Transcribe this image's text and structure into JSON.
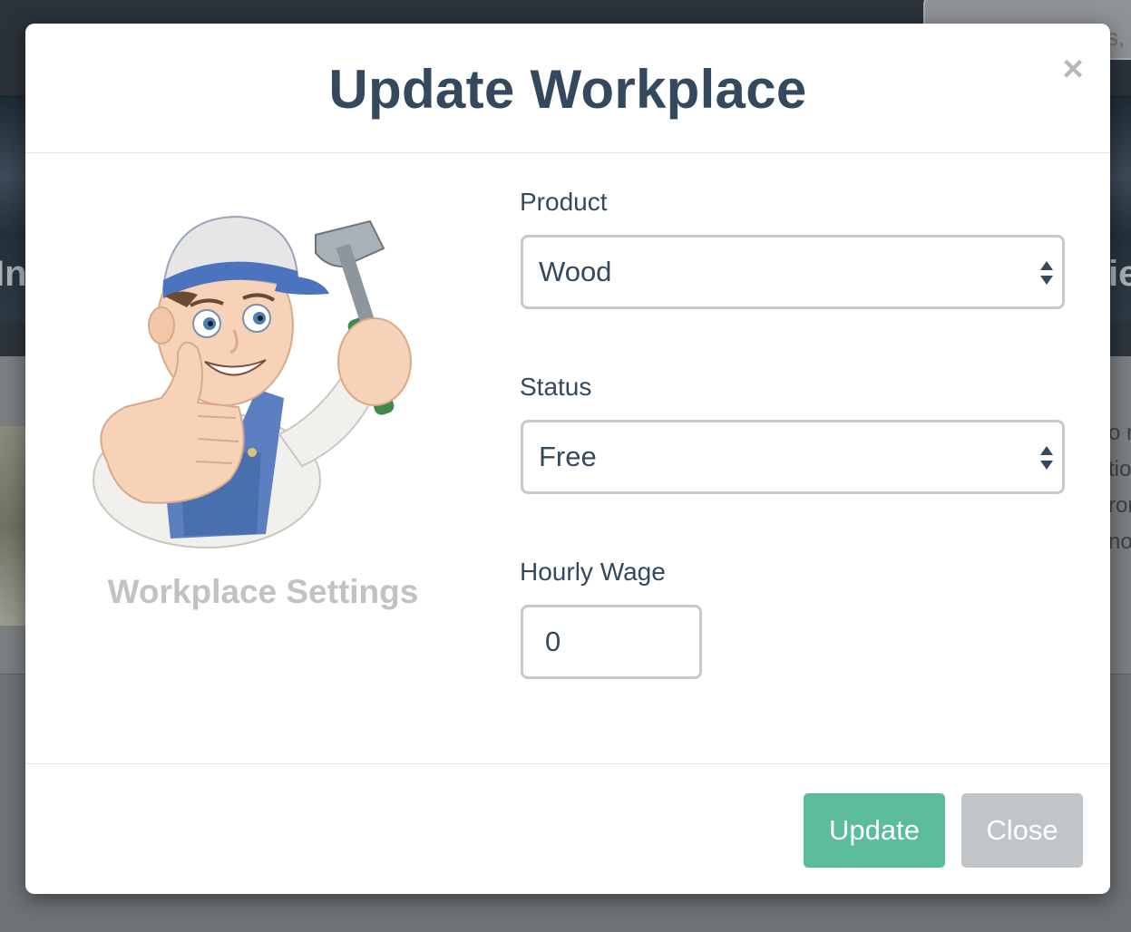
{
  "background": {
    "search_fragment": "s,",
    "hero_left_fragment": "In",
    "hero_right_fragment": "ie",
    "content_fragments": [
      "o r",
      "tio",
      "ror",
      "nov"
    ]
  },
  "modal": {
    "title": "Update Workplace",
    "close_symbol": "×",
    "illustration": "worker-with-hammer-thumbs-up",
    "caption": "Workplace Settings",
    "fields": {
      "product": {
        "label": "Product",
        "value": "Wood"
      },
      "status": {
        "label": "Status",
        "value": "Free"
      },
      "hourly_wage": {
        "label": "Hourly Wage",
        "value": "0"
      }
    },
    "buttons": {
      "update": "Update",
      "close": "Close"
    }
  },
  "colors": {
    "title": "#34495e",
    "update_button": "#5bbd9b",
    "close_button": "#c1c5c8",
    "caption": "#bfc3c6"
  }
}
